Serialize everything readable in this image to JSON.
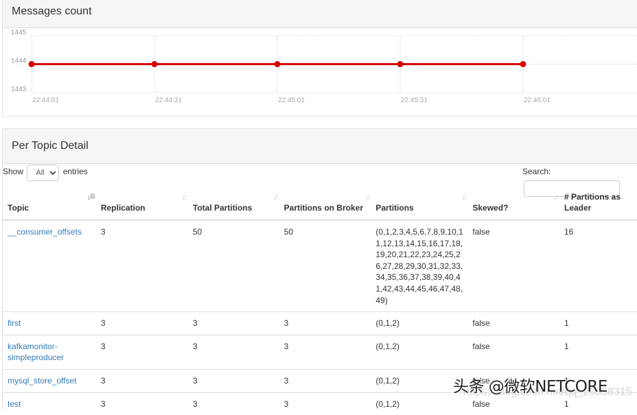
{
  "chart_panel": {
    "title": "Messages count"
  },
  "chart_data": {
    "type": "line",
    "title": "Messages count",
    "xlabel": "",
    "ylabel": "",
    "x": [
      "22:44:01",
      "22:44:31",
      "22:45:01",
      "22:45:31",
      "22:46:01"
    ],
    "series": [
      {
        "name": "Messages count",
        "values": [
          1444,
          1444,
          1444,
          1444,
          1444
        ],
        "color": "#d90000"
      }
    ],
    "y_ticks": [
      1445,
      1444,
      1443
    ],
    "ylim": [
      1443,
      1445
    ],
    "grid": true,
    "legend": "none"
  },
  "detail_panel": {
    "title": "Per Topic Detail",
    "show_label": "Show",
    "entries_label": "entries",
    "length_selected": "All",
    "search_label": "Search:",
    "search_value": ""
  },
  "table": {
    "columns": [
      "Topic",
      "Replication",
      "Total Partitions",
      "Partitions on Broker",
      "Partitions",
      "Skewed?",
      "# Partitions as Leader"
    ],
    "rows": [
      {
        "topic": "__consumer_offsets",
        "replication": "3",
        "total_partitions": "50",
        "partitions_on_broker": "50",
        "partitions": "(0,1,2,3,4,5,6,7,8,9,10,11,12,13,14,15,16,17,18,19,20,21,22,23,24,25,26,27,28,29,30,31,32,33,34,35,36,37,38,39,40,41,42,43,44,45,46,47,48,49)",
        "skewed": "false",
        "leader": "16"
      },
      {
        "topic": "first",
        "replication": "3",
        "total_partitions": "3",
        "partitions_on_broker": "3",
        "partitions": "(0,1,2)",
        "skewed": "false",
        "leader": "1"
      },
      {
        "topic": "kafkamonitor-simpleproducer",
        "replication": "3",
        "total_partitions": "3",
        "partitions_on_broker": "3",
        "partitions": "(0,1,2)",
        "skewed": "false",
        "leader": "1"
      },
      {
        "topic": "mysql_store_offset",
        "replication": "3",
        "total_partitions": "3",
        "partitions_on_broker": "3",
        "partitions": "(0,1,2)",
        "skewed": "false",
        "leader": "1"
      },
      {
        "topic": "test",
        "replication": "3",
        "total_partitions": "3",
        "partitions_on_broker": "3",
        "partitions": "(0,1,2)",
        "skewed": "false",
        "leader": "1"
      }
    ]
  },
  "watermark": {
    "text": "头条 @微软NETCORE",
    "faint": "https://blog.csdn.net/qq_26838315"
  }
}
